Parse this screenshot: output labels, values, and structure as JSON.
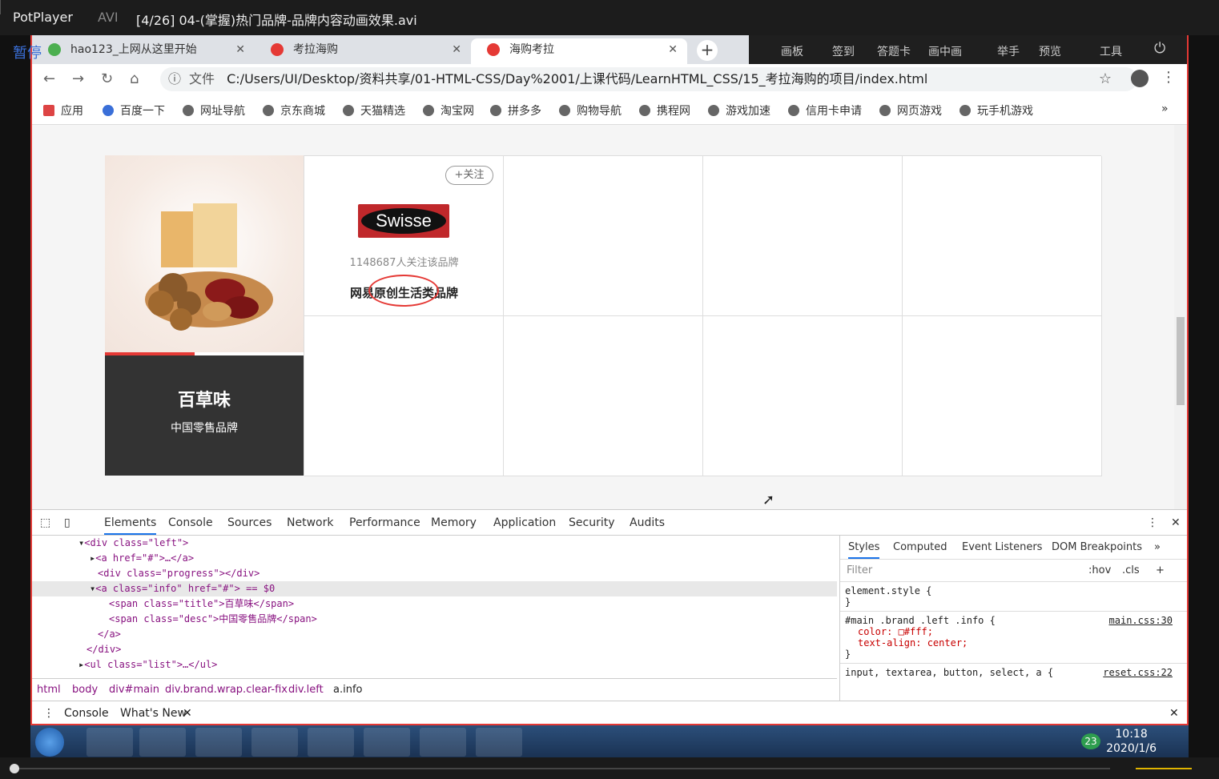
{
  "player": {
    "app": "PotPlayer",
    "format": "AVI",
    "title": "[4/26] 04-(掌握)热门品牌-品牌内容动画效果.avi",
    "pause": "暂停",
    "menu": [
      "画板",
      "签到",
      "答题卡",
      "画中画",
      "举手",
      "预览",
      "工具"
    ],
    "seek_progress_fraction": 0.01
  },
  "browser": {
    "tabs": [
      {
        "label": "hao123_上网从这里开始"
      },
      {
        "label": "考拉海购"
      },
      {
        "label": "海购考拉",
        "active": true
      }
    ],
    "url_prefix": "文件",
    "url": "C:/Users/UI/Desktop/资料共享/01-HTML-CSS/Day%2001/上课代码/LearnHTML_CSS/15_考拉海购的项目/index.html",
    "bookmarks": [
      "应用",
      "百度一下",
      "网址导航",
      "京东商城",
      "天猫精选",
      "淘宝网",
      "拼多多",
      "购物导航",
      "携程网",
      "游戏加速",
      "信用卡申请",
      "网页游戏",
      "玩手机游戏"
    ]
  },
  "page": {
    "left": {
      "title": "百草味",
      "desc": "中国零售品牌"
    },
    "brand_cell": {
      "follow": "+关注",
      "logo": "Swisse",
      "fans": "1148687人关注该品牌",
      "desc": "网易原创生活类品牌"
    }
  },
  "devtools": {
    "tabs": [
      "Elements",
      "Console",
      "Sources",
      "Network",
      "Performance",
      "Memory",
      "Application",
      "Security",
      "Audits"
    ],
    "code": [
      "<div class=\"left\">",
      "<a href=\"#\">…</a>",
      "<div class=\"progress\"></div>",
      "<a class=\"info\" href=\"#\"> == $0",
      "<span class=\"title\">百草味</span>",
      "<span class=\"desc\">中国零售品牌</span>",
      "</a>",
      "</div>",
      "<ul class=\"list\">…</ul>"
    ],
    "breadcrumbs": [
      "html",
      "body",
      "div#main",
      "div.brand.wrap.clear-fix",
      "div.left",
      "a.info"
    ],
    "styles_tabs": [
      "Styles",
      "Computed",
      "Event Listeners",
      "DOM Breakpoints"
    ],
    "filter_placeholder": "Filter",
    "hov": ":hov",
    "cls": ".cls",
    "rules": [
      {
        "selector": "element.style {",
        "props": [],
        "close": "}",
        "src": ""
      },
      {
        "selector": "#main .brand .left .info {",
        "props": [
          "color: □#fff;",
          "text-align: center;"
        ],
        "close": "}",
        "src": "main.css:30"
      },
      {
        "selector": "input, textarea, button, select, a {",
        "props": [],
        "close": "",
        "src": "reset.css:22"
      }
    ],
    "drawer": [
      "Console",
      "What's New"
    ]
  },
  "taskbar": {
    "time": "10:18",
    "date": "2020/1/6",
    "badge": "23"
  },
  "colors": {
    "accent": "#e53935",
    "dark": "#333333"
  }
}
